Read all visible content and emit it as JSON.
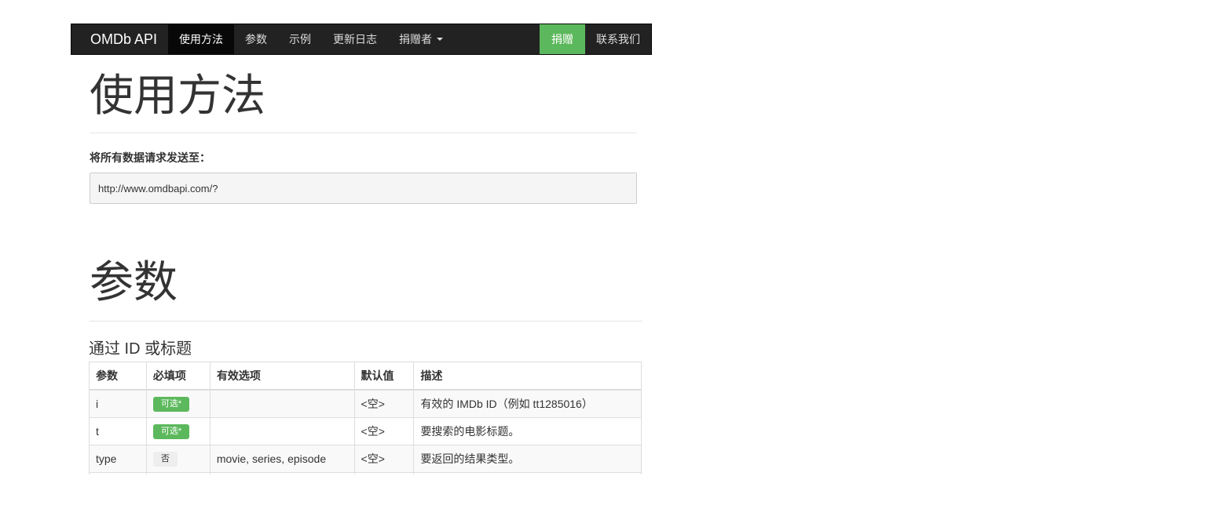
{
  "navbar": {
    "brand": "OMDb API",
    "items": [
      {
        "label": "使用方法",
        "active": true
      },
      {
        "label": "参数"
      },
      {
        "label": "示例"
      },
      {
        "label": "更新日志"
      },
      {
        "label": "捐赠者"
      }
    ],
    "donate": "捐赠",
    "contact": "联系我们"
  },
  "usage": {
    "title": "使用方法",
    "send_label": "将所有数据请求发送至：",
    "url": "http://www.omdbapi.com/?"
  },
  "params": {
    "title": "参数",
    "subtitle": "通过 ID 或标题",
    "headers": [
      "参数",
      "必填项",
      "有效选项",
      "默认值",
      "描述"
    ],
    "rows": [
      {
        "param": "i",
        "required": "可选*",
        "options": "",
        "default": "<空>",
        "desc": "有效的 IMDb ID（例如 tt1285016）"
      },
      {
        "param": "t",
        "required": "可选*",
        "options": "",
        "default": "<空>",
        "desc": "要搜索的电影标题。"
      },
      {
        "param": "type",
        "required": "否",
        "options": "movie, series, episode",
        "default": "<空>",
        "desc": "要返回的结果类型。"
      },
      {
        "param": "",
        "required": "",
        "options": "",
        "default": "",
        "desc": ""
      }
    ]
  },
  "colors": {
    "navbar_bg": "#222222",
    "donate_green": "#5cb85c"
  }
}
